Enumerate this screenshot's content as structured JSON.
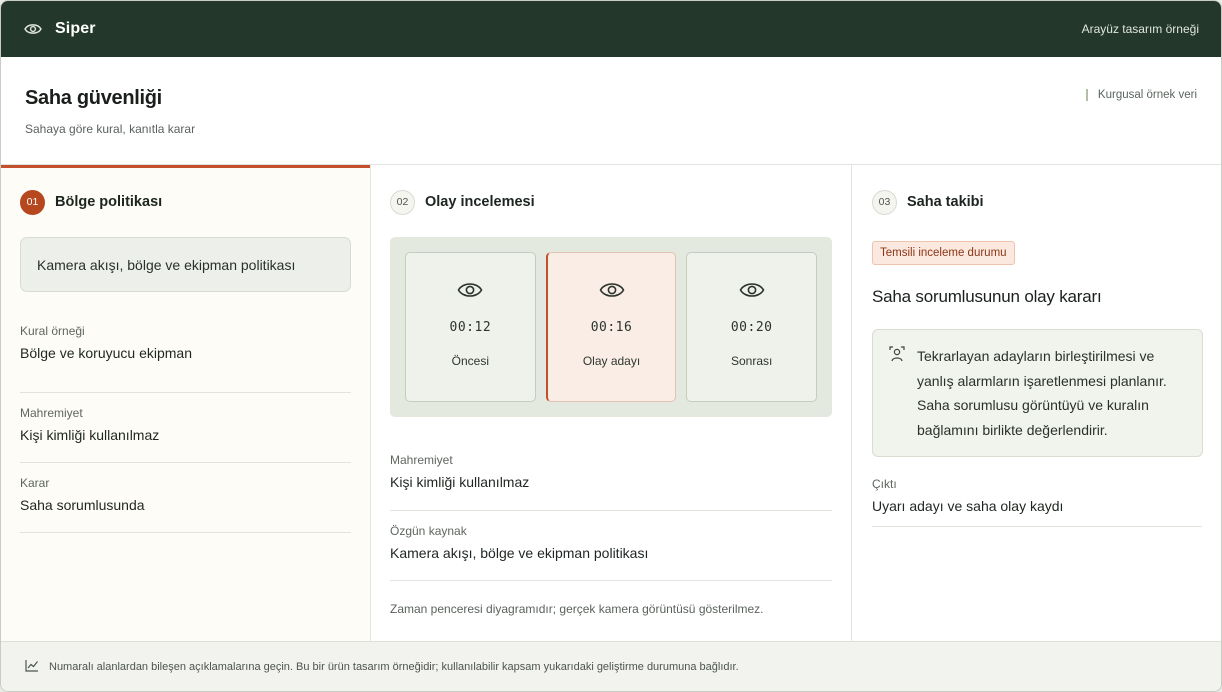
{
  "app": {
    "name": "Siper",
    "tagline": "Arayüz tasarım örneği"
  },
  "header": {
    "title": "Saha güvenliği",
    "subtitle": "Sahaya göre kural, kanıtla karar",
    "badge": "Kurgusal örnek veri"
  },
  "policy": {
    "number": "01",
    "title": "Bölge politikası",
    "source": "Kamera akışı, bölge ve ekipman politikası",
    "fields": [
      {
        "label": "Kural örneği",
        "value": "Bölge ve koruyucu ekipman"
      },
      {
        "label": "Mahremiyet",
        "value": "Kişi kimliği kullanılmaz"
      },
      {
        "label": "Karar",
        "value": "Saha sorumlusunda"
      }
    ]
  },
  "review": {
    "number": "02",
    "title": "Olay incelemesi",
    "frames": [
      {
        "time": "00:12",
        "label": "Öncesi",
        "focused": false
      },
      {
        "time": "00:16",
        "label": "Olay adayı",
        "focused": true
      },
      {
        "time": "00:20",
        "label": "Sonrası",
        "focused": false
      }
    ],
    "fields": [
      {
        "label": "Mahremiyet",
        "value": "Kişi kimliği kullanılmaz"
      },
      {
        "label": "Özgün kaynak",
        "value": "Kamera akışı, bölge ve ekipman politikası"
      }
    ],
    "note": "Zaman penceresi diyagramıdır; gerçek kamera görüntüsü gösterilmez."
  },
  "tracking": {
    "number": "03",
    "title": "Saha takibi",
    "status_pill": "Temsili inceleme durumu",
    "decision_title": "Saha sorumlusunun olay kararı",
    "info": "Tekrarlayan adayların birleştirilmesi ve yanlış alarmların işaretlenmesi planlanır. Saha sorumlusu görüntüyü ve kuralın bağlamını birlikte değerlendirir.",
    "fields": [
      {
        "label": "Çıktı",
        "value": "Uyarı adayı ve saha olay kaydı"
      }
    ]
  },
  "footer": {
    "text": "Numaralı alanlardan bileşen açıklamalarına geçin. Bu bir ürün tasarım örneğidir; kullanılabilir kapsam yukarıdaki geliştirme durumuna bağlıdır."
  },
  "icons": {
    "brand": "eye-icon",
    "frame": "eye-icon",
    "info": "person-scan-icon",
    "footer": "chart-line-icon"
  },
  "colors": {
    "topbar": "#24372b",
    "accent": "#c3502b",
    "pill_bg": "#fbe8de"
  }
}
